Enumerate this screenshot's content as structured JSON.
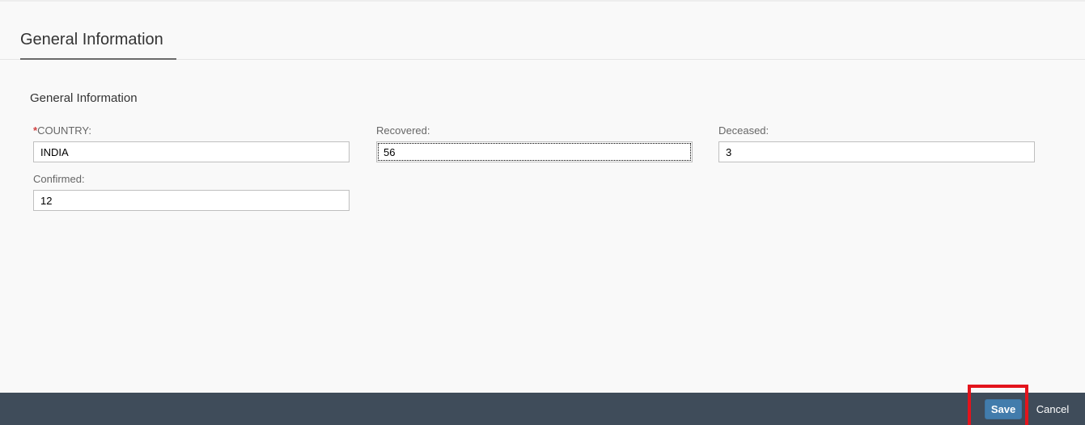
{
  "header": {
    "tab_title": "General Information"
  },
  "section": {
    "title": "General Information"
  },
  "fields": {
    "country": {
      "label": "COUNTRY:",
      "required_marker": "*",
      "value": "INDIA"
    },
    "recovered": {
      "label": "Recovered:",
      "value": "56"
    },
    "deceased": {
      "label": "Deceased:",
      "value": "3"
    },
    "confirmed": {
      "label": "Confirmed:",
      "value": "12"
    }
  },
  "footer": {
    "save_label": "Save",
    "cancel_label": "Cancel"
  },
  "colors": {
    "footer_background": "#3f4c5a",
    "save_button": "#427cac",
    "highlight": "#e3141c",
    "required_marker": "#d04343"
  }
}
